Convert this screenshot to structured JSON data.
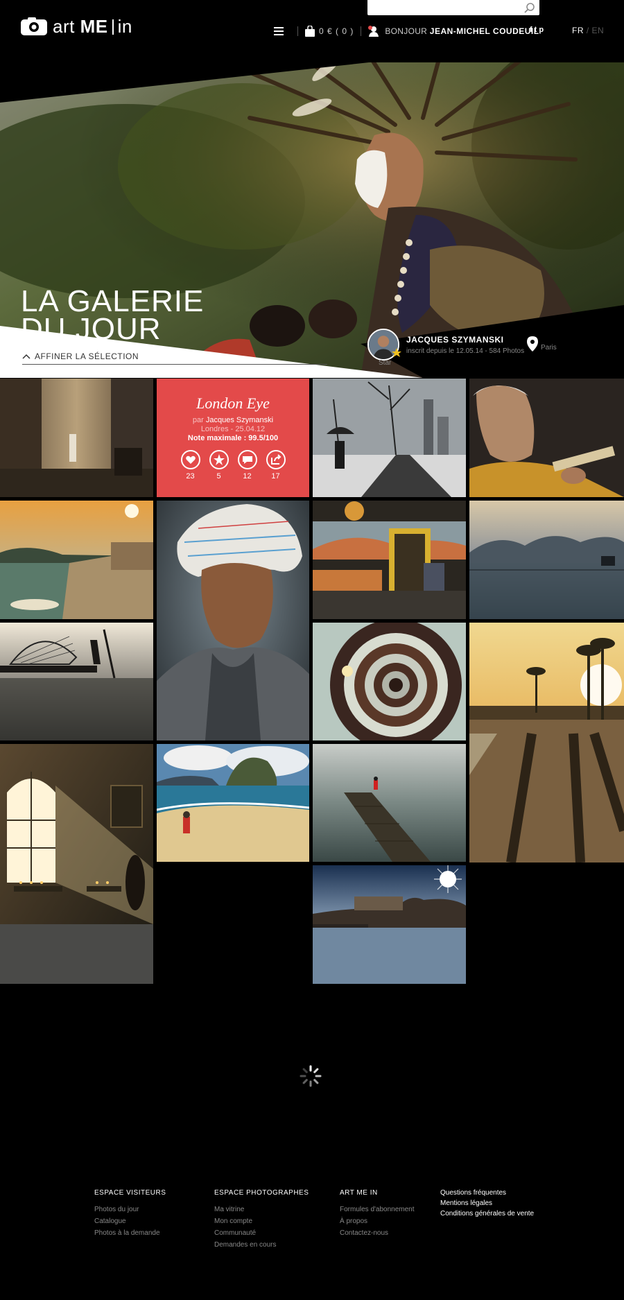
{
  "header": {
    "logo_word": "art",
    "logo_me": "ME",
    "logo_in": "in",
    "search_placeholder": "",
    "cart": "0 € ( 0 )",
    "greeting": "BONJOUR",
    "user_name": "JEAN-MICHEL COUDEUIL",
    "social": [
      "f",
      "t",
      "p"
    ],
    "lang_fr": "FR",
    "lang_sep": "/",
    "lang_en": "EN"
  },
  "hero": {
    "title_line1": "LA GALERIE",
    "title_line2": "DU JOUR",
    "refine_label": "AFFINER LA SÉLECTION",
    "photographer": {
      "name": "JACQUES SZYMANSKI",
      "meta": "inscrit depuis le 12.05.14 - 584 Photos",
      "rank": "Star",
      "location": "Paris"
    }
  },
  "feature": {
    "title": "London Eye",
    "by_prefix": "par",
    "author": "Jacques Szymanski",
    "place_date": "Londres - 25.04.12",
    "score": "Note maximale : 99.5/100",
    "stats": {
      "likes": "23",
      "favorites": "5",
      "comments": "12",
      "shares": "17"
    }
  },
  "colors": {
    "accent": "#e34a4a",
    "background": "#000000"
  },
  "footer": {
    "visitors": {
      "title": "ESPACE VISITEURS",
      "links": [
        "Photos du jour",
        "Catalogue",
        "Photos à la demande"
      ]
    },
    "photographers": {
      "title": "ESPACE PHOTOGRAPHES",
      "links": [
        "Ma vitrine",
        "Mon compte",
        "Communauté",
        "Demandes en cours"
      ]
    },
    "artmein": {
      "title": "ART ME IN",
      "links": [
        "Formules d'abonnement",
        "À propos",
        "Contactez-nous"
      ]
    },
    "legal": {
      "links": [
        "Questions fréquentes",
        "Mentions légales",
        "Conditions générales de vente"
      ]
    }
  }
}
